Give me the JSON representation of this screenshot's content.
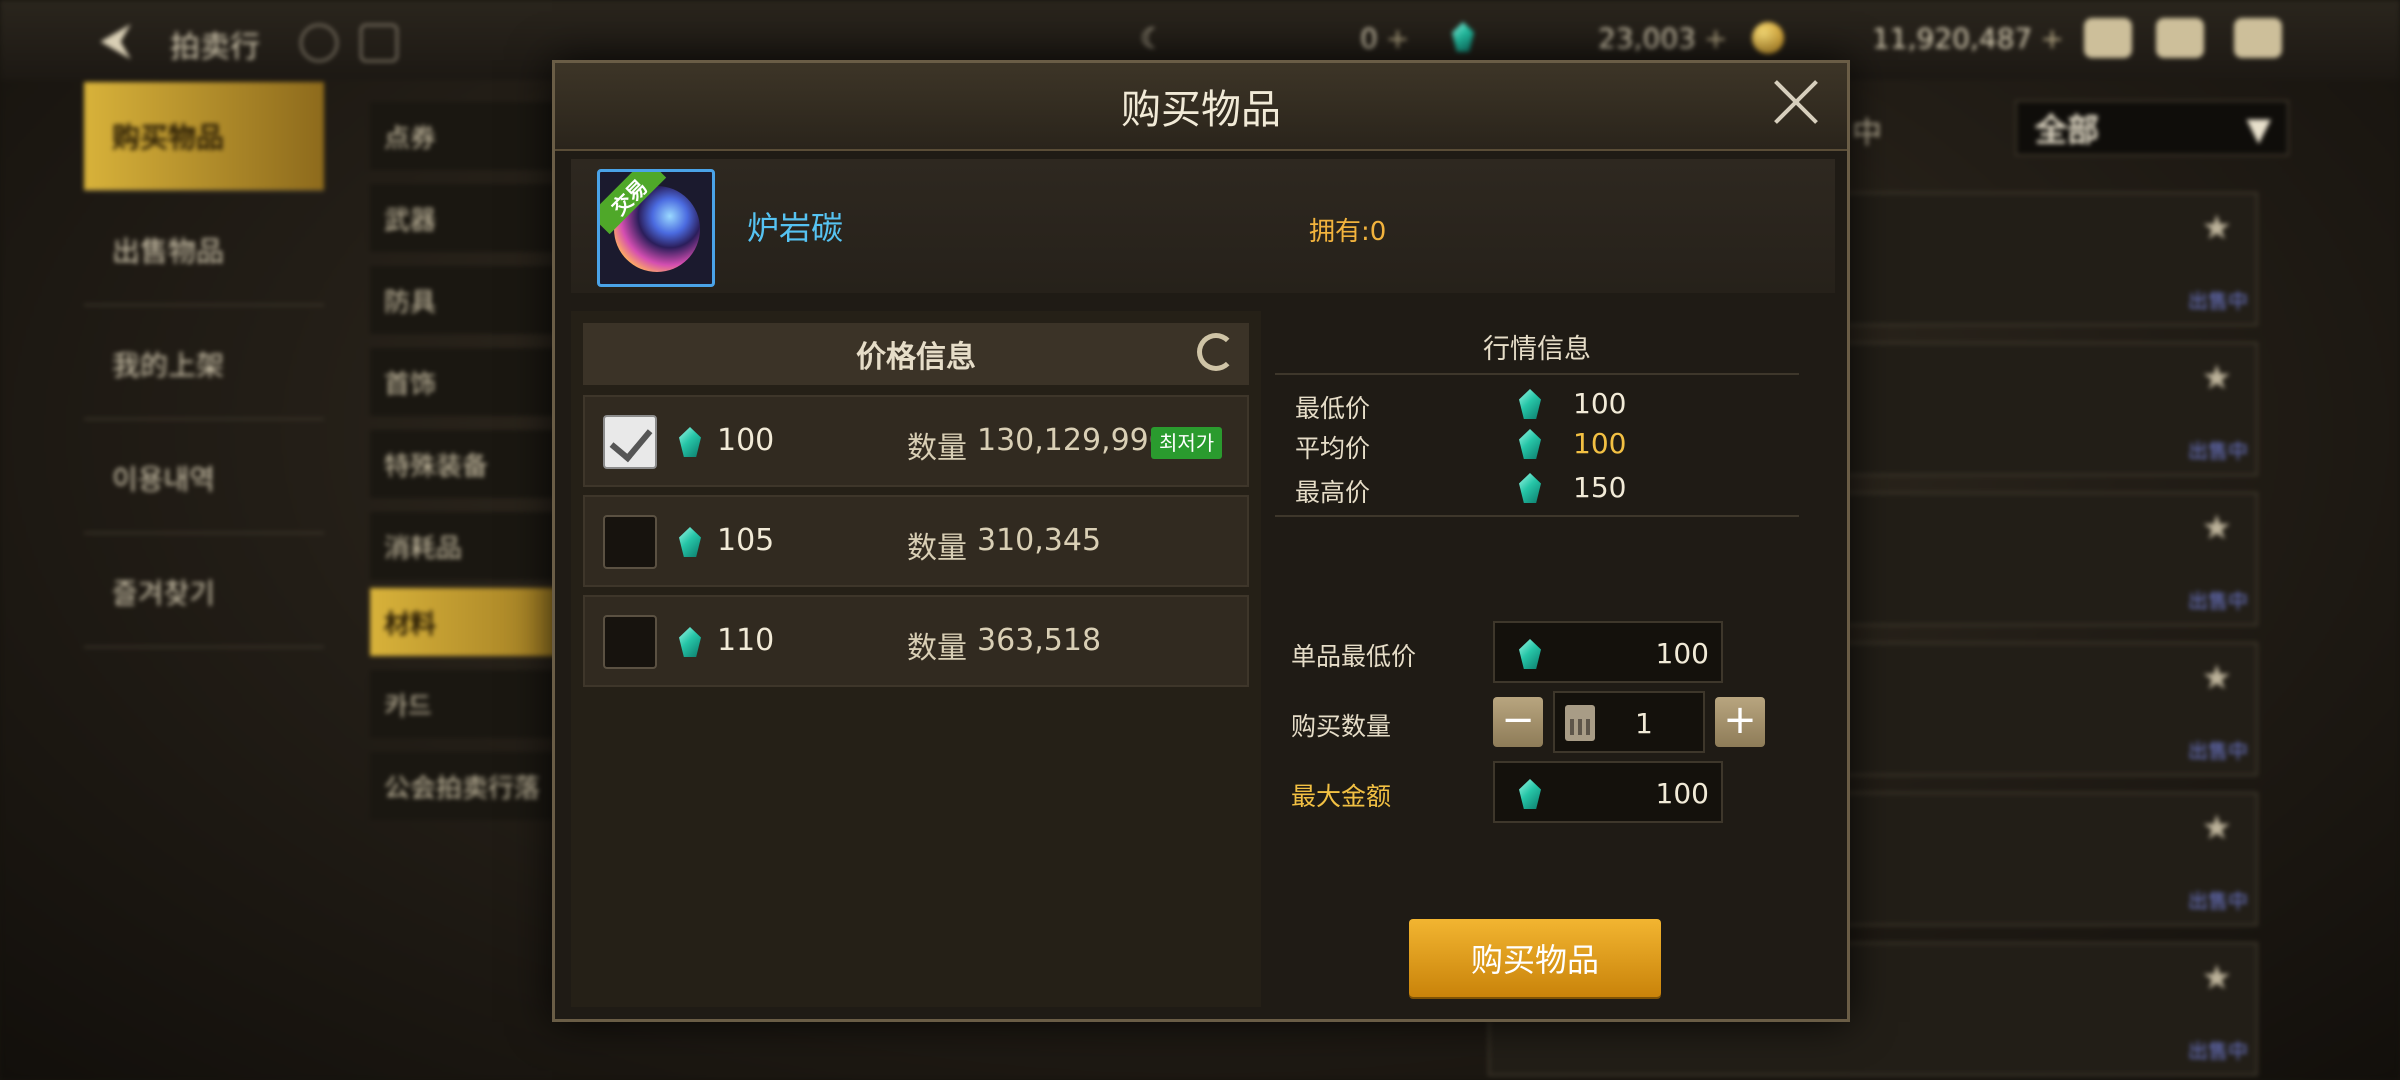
{
  "background": {
    "header": {
      "title": "拍卖行",
      "currencies": [
        {
          "icon": "crescent-coin-icon",
          "value": "0"
        },
        {
          "icon": "teal-gem-icon",
          "value": "23,003"
        },
        {
          "icon": "gold-coin-icon",
          "value": "11,920,487"
        }
      ],
      "plus": "+"
    },
    "left_nav": [
      "购买物品",
      "出售物品",
      "我的上架",
      "이용내역",
      "즐겨찾기"
    ],
    "categories": [
      "点券",
      "武器",
      "防具",
      "首饰",
      "特殊装备",
      "消耗品",
      "材料",
      "카드",
      "公会拍卖行落"
    ],
    "filter": {
      "selected": "全部",
      "partial_label": "中"
    },
    "listing_status": "出售中"
  },
  "modal": {
    "title": "购买物品",
    "item": {
      "name": "炉岩碳",
      "tag": "交易",
      "owned": "拥有:0"
    },
    "price_panel": {
      "header": "价格信息",
      "qty_label": "数量",
      "lowest_badge": "최저가",
      "rows": [
        {
          "price": "100",
          "qty": "130,129,990",
          "checked": true
        },
        {
          "price": "105",
          "qty": "310,345",
          "checked": false
        },
        {
          "price": "110",
          "qty": "363,518",
          "checked": false
        }
      ]
    },
    "market": {
      "header": "行情信息",
      "rows": [
        {
          "label": "最低价",
          "value": "100"
        },
        {
          "label": "平均价",
          "value": "100"
        },
        {
          "label": "最高价",
          "value": "150"
        }
      ]
    },
    "form": {
      "unit_min_label": "单品最低价",
      "unit_min_value": "100",
      "qty_label": "购买数量",
      "qty_value": "1",
      "minus": "−",
      "plus": "+",
      "max_label": "最大金额",
      "max_value": "100"
    },
    "buy_button": "购买物品"
  },
  "colors": {
    "accent_gold": "#f2b531",
    "item_name": "#56c3f2",
    "lowest_badge": "#2a9b2e"
  }
}
